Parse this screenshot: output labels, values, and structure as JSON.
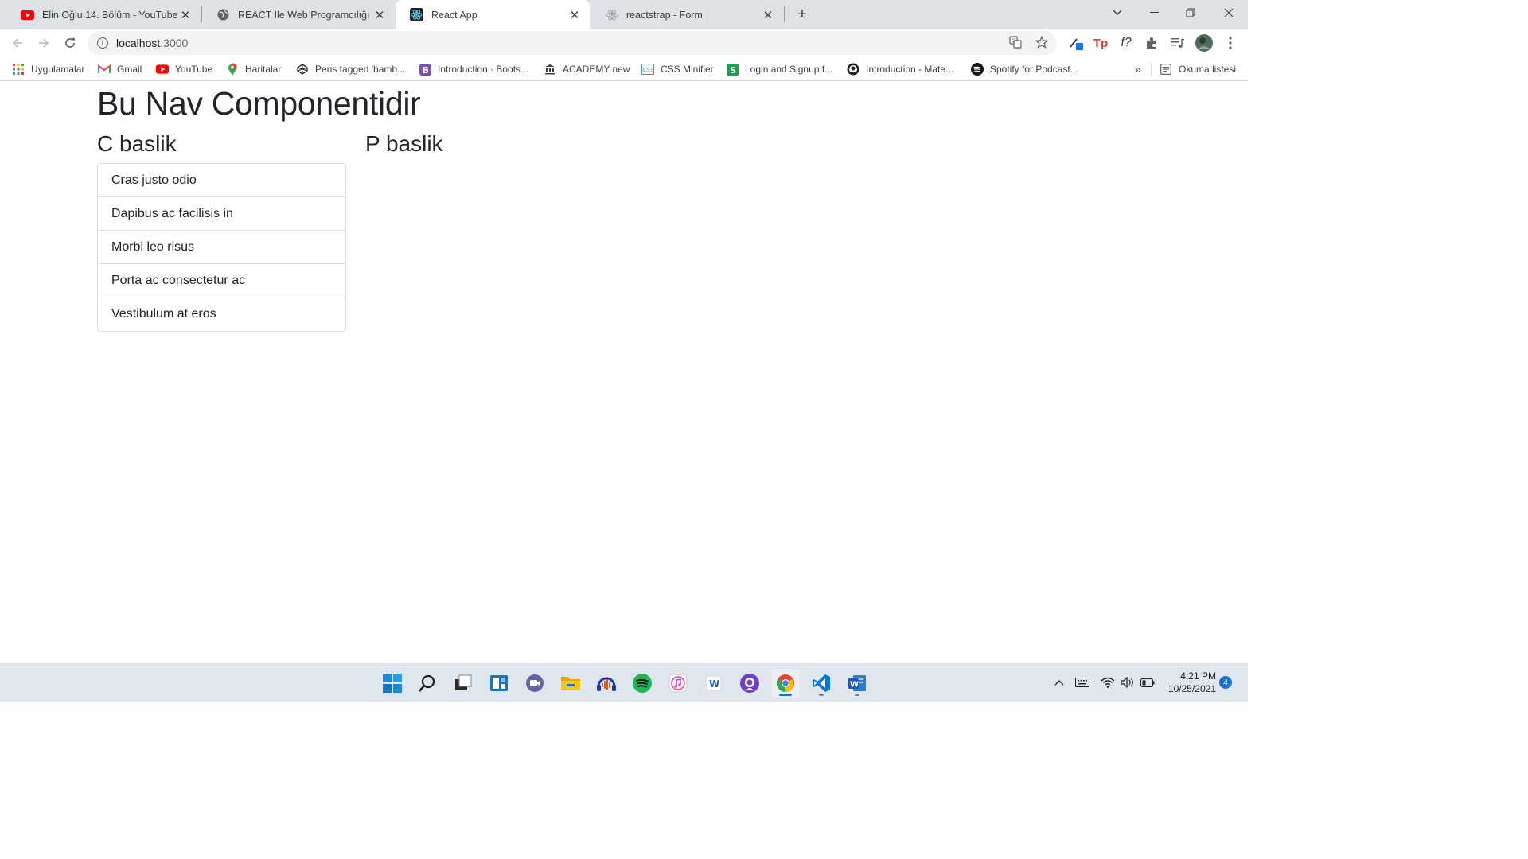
{
  "browser": {
    "tabs": [
      {
        "title": "Elin Oğlu 14. Bölüm - YouTube",
        "favicon": "youtube-icon",
        "active": false
      },
      {
        "title": "REACT İle Web Programcılığı",
        "favicon": "globe-icon",
        "active": false
      },
      {
        "title": "React App",
        "favicon": "react-icon",
        "active": true
      },
      {
        "title": "reactstrap - Form",
        "favicon": "react-icon",
        "active": false
      }
    ],
    "new_tab": "+",
    "address": {
      "host": "localhost",
      "port": ":3000"
    },
    "bookmarks": [
      {
        "label": "Uygulamalar",
        "icon": "apps-grid-icon"
      },
      {
        "label": "Gmail",
        "icon": "gmail-icon"
      },
      {
        "label": "YouTube",
        "icon": "youtube-icon"
      },
      {
        "label": "Haritalar",
        "icon": "maps-pin-icon"
      },
      {
        "label": "Pens tagged 'hamb...",
        "icon": "codepen-icon"
      },
      {
        "label": "Introduction · Boots...",
        "icon": "bootstrap-icon"
      },
      {
        "label": "ACADEMY new",
        "icon": "academy-icon"
      },
      {
        "label": "CSS Minifier",
        "icon": "css-icon"
      },
      {
        "label": "Login and Signup f...",
        "icon": "s-icon"
      },
      {
        "label": "Introduction - Mate...",
        "icon": "github-icon"
      },
      {
        "label": "Spotify for Podcast...",
        "icon": "spotify-icon"
      }
    ],
    "bookmarks_overflow": "»",
    "reading_list": "Okuma listesi"
  },
  "page": {
    "heading": "Bu Nav Componentidir",
    "left_title": "C baslik",
    "right_title": "P baslik",
    "list_items": [
      "Cras justo odio",
      "Dapibus ac facilisis in",
      "Morbi leo risus",
      "Porta ac consectetur ac",
      "Vestibulum at eros"
    ]
  },
  "taskbar": {
    "apps": [
      "windows-start-icon",
      "search-icon",
      "task-view-icon",
      "widgets-icon",
      "teams-chat-icon",
      "file-explorer-icon",
      "audacity-icon",
      "spotify-icon",
      "itunes-icon",
      "wordpad-icon",
      "github-desktop-icon",
      "chrome-icon",
      "vscode-icon",
      "word-icon"
    ],
    "time": "4:21 PM",
    "date": "10/25/2021",
    "notifications": "4"
  },
  "colors": {
    "tab_strip": "#dee1e6",
    "taskbar": "#dfe6ee",
    "heading_text": "#212529",
    "list_border": "#dfdfdf"
  }
}
